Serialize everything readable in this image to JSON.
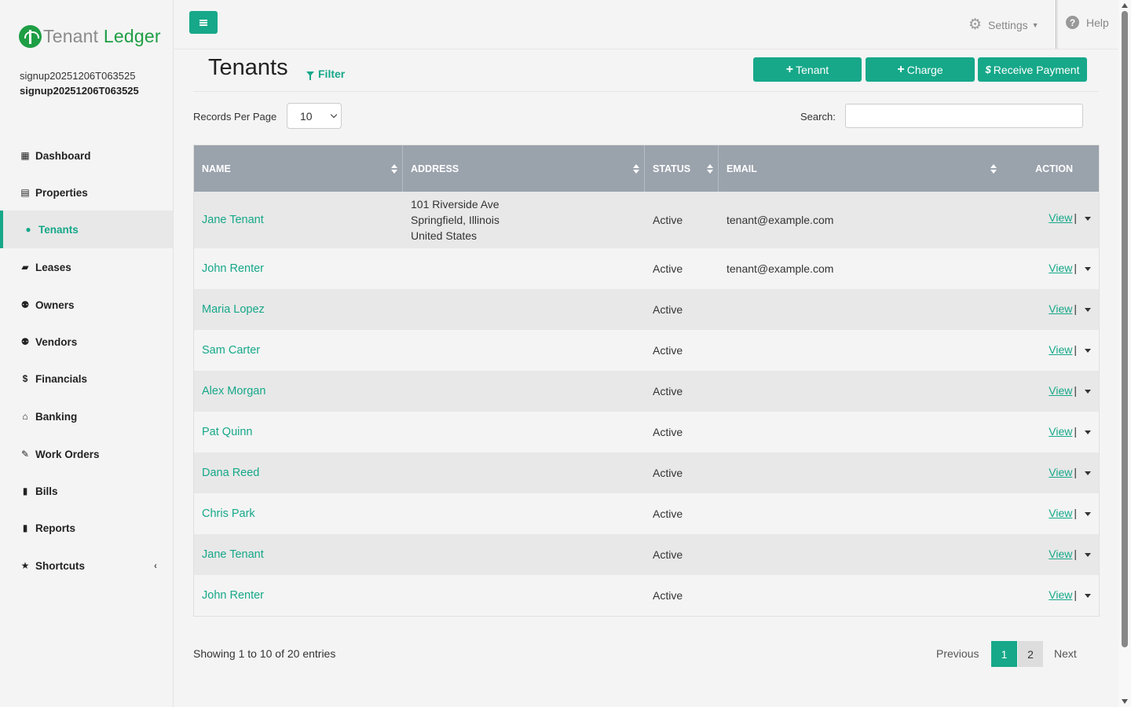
{
  "brand": {
    "name_part1": "Tenant",
    "name_part2": "Ledger",
    "accent": "#16a889",
    "logo_green": "#1e9e45"
  },
  "user": {
    "line1": "signup20251206T063525",
    "line2": "signup20251206T063525"
  },
  "sidebar": {
    "items": [
      {
        "label": "Dashboard",
        "icon": "th-large-icon"
      },
      {
        "label": "Properties",
        "icon": "building-icon"
      },
      {
        "label": "Tenants",
        "icon": "user-icon",
        "active": true
      },
      {
        "label": "Leases",
        "icon": "folder-open-icon"
      },
      {
        "label": "Owners",
        "icon": "users-icon"
      },
      {
        "label": "Vendors",
        "icon": "users-icon"
      },
      {
        "label": "Financials",
        "icon": "dollar-icon"
      },
      {
        "label": "Banking",
        "icon": "bank-icon"
      },
      {
        "label": "Work Orders",
        "icon": "edit-icon"
      },
      {
        "label": "Bills",
        "icon": "file-icon"
      },
      {
        "label": "Reports",
        "icon": "file-icon"
      },
      {
        "label": "Shortcuts",
        "icon": "star-icon"
      }
    ]
  },
  "topbar": {
    "settings_label": "Settings",
    "help_label": "Help"
  },
  "page": {
    "title": "Tenants",
    "filter_label": "Filter",
    "buttons": {
      "tenant": "Tenant",
      "charge": "Charge",
      "receive_payment": "Receive Payment"
    },
    "records_per_page_label": "Records Per Page",
    "records_per_page_value": "10",
    "search_label": "Search:",
    "search_value": ""
  },
  "table": {
    "columns": [
      "NAME",
      "ADDRESS",
      "STATUS",
      "EMAIL",
      "ACTION"
    ],
    "rows": [
      {
        "name": "Jane Tenant",
        "address": [
          "101 Riverside Ave",
          "Springfield, Illinois",
          "United States"
        ],
        "status": "Active",
        "email": "tenant@example.com",
        "action": "View"
      },
      {
        "name": "John Renter",
        "address": [],
        "status": "Active",
        "email": "tenant@example.com",
        "action": "View"
      },
      {
        "name": "Maria Lopez",
        "address": [],
        "status": "Active",
        "email": "",
        "action": "View"
      },
      {
        "name": "Sam Carter",
        "address": [],
        "status": "Active",
        "email": "",
        "action": "View"
      },
      {
        "name": "Alex Morgan",
        "address": [],
        "status": "Active",
        "email": "",
        "action": "View"
      },
      {
        "name": "Pat Quinn",
        "address": [],
        "status": "Active",
        "email": "",
        "action": "View"
      },
      {
        "name": "Dana Reed",
        "address": [],
        "status": "Active",
        "email": "",
        "action": "View"
      },
      {
        "name": "Chris Park",
        "address": [],
        "status": "Active",
        "email": "",
        "action": "View"
      },
      {
        "name": "Jane Tenant",
        "address": [],
        "status": "Active",
        "email": "",
        "action": "View"
      },
      {
        "name": "John Renter",
        "address": [],
        "status": "Active",
        "email": "",
        "action": "View"
      }
    ]
  },
  "footer": {
    "showing": "Showing 1 to 10 of 20 entries",
    "previous": "Previous",
    "pages": [
      "1",
      "2"
    ],
    "current_page": "1",
    "next": "Next"
  }
}
